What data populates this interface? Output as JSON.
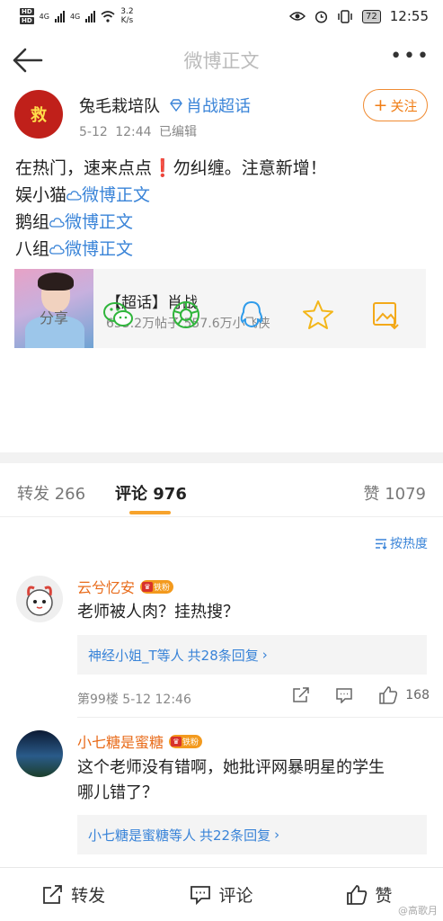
{
  "status_bar": {
    "hd1": "HD",
    "hd2": "HD",
    "net1": "4G",
    "net2": "4G",
    "speed_value": "3.2",
    "speed_unit": "K/s",
    "battery": "72",
    "time": "12:55"
  },
  "nav": {
    "title": "微博正文"
  },
  "post": {
    "avatar_text": "救",
    "author": "兔毛栽培队",
    "topic": "肖战超话",
    "date": "5-12 12:44",
    "edited": "已编辑",
    "follow_label": "关注",
    "line1_a": "在热门，速来点点",
    "line1_mark": "❗",
    "line1_b": "勿纠缠。注意新增！",
    "lines": [
      {
        "prefix": "娱小猫",
        "link": "微博正文"
      },
      {
        "prefix": "鹅组",
        "link": "微博正文"
      },
      {
        "prefix": "八组",
        "link": "微博正文"
      }
    ],
    "card": {
      "title": "【超话】肖战",
      "subtitle": "655.2万帖子 557.6万小飞侠"
    }
  },
  "share": {
    "label": "分享"
  },
  "tabs": {
    "repost": "转发 266",
    "comments": "评论 976",
    "likes": "赞 1079"
  },
  "sort_label": "按热度",
  "comments": [
    {
      "name": "云兮忆安",
      "badge": "铁粉",
      "text": "老师被人肉？挂热搜？",
      "reply_users": "神经小姐_T等人",
      "reply_count": "共28条回复",
      "floor": "第99楼",
      "time": "5-12 12:46",
      "likes": "168"
    },
    {
      "name": "小七糖是蜜糖",
      "badge": "铁粉",
      "text_l1": "这个老师没有错啊，她批评网暴明星的学生",
      "text_l2": "哪儿错了？",
      "reply_users": "小七糖是蜜糖等人",
      "reply_count": "共22条回复"
    }
  ],
  "bottom_bar": {
    "repost": "转发",
    "comment": "评论",
    "like": "赞"
  },
  "watermark": "@高歌月"
}
